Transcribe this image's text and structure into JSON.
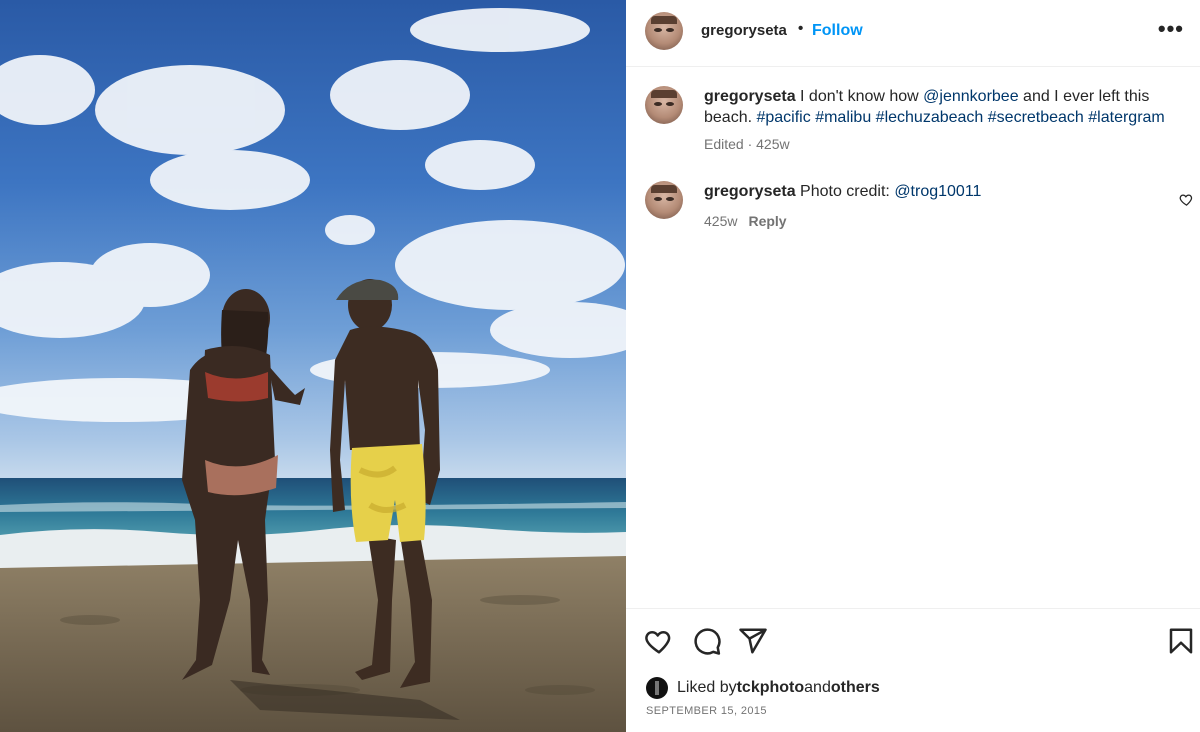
{
  "post": {
    "photo_description_icon": "beach-photo",
    "author": {
      "username": "gregoryseta",
      "separator": "•",
      "follow_label": "Follow",
      "more_label": "•••"
    },
    "caption": {
      "username": "gregoryseta",
      "text_1": " I don't know how ",
      "mention": "@jennkorbee",
      "text_2": " and I ever left this beach. ",
      "hashtags": [
        "#pacific",
        "#malibu",
        "#lechuzabeach",
        "#secretbeach",
        "#latergram"
      ],
      "meta": "Edited · 425w"
    },
    "comments": [
      {
        "username": "gregoryseta",
        "text": " Photo credit: ",
        "mention": "@trog10011",
        "time": "425w",
        "reply_label": "Reply"
      }
    ],
    "actions": {
      "like_icon": "heart-icon",
      "comment_icon": "comment-icon",
      "share_icon": "share-icon",
      "save_icon": "bookmark-icon"
    },
    "likes": {
      "prefix": "Liked by",
      "user": "tckphoto",
      "middle": "and",
      "suffix": "others"
    },
    "date": "SEPTEMBER 15, 2015"
  },
  "colors": {
    "link": "#00376b",
    "follow": "#0095f6",
    "muted": "#737373"
  }
}
